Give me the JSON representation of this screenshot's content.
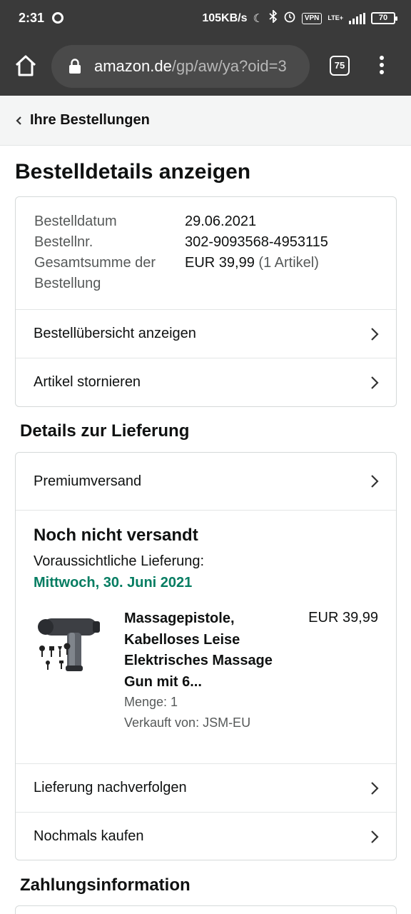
{
  "status_bar": {
    "time": "2:31",
    "speed": "105KB/s",
    "vpn": "VPN",
    "network": "LTE+",
    "battery": "70"
  },
  "browser": {
    "url_domain": "amazon.de",
    "url_path": "/gp/aw/ya?oid=3",
    "tab_count": "75"
  },
  "nav": {
    "back_label": "Ihre Bestellungen"
  },
  "page": {
    "title": "Bestelldetails anzeigen"
  },
  "summary": {
    "rows": [
      {
        "key": "Bestelldatum",
        "value": "29.06.2021"
      },
      {
        "key": "Bestellnr.",
        "value": "302-9093568-4953115"
      },
      {
        "key": "Gesamtsumme der Bestellung",
        "value": "EUR 39,99",
        "extra": "(1 Artikel)"
      }
    ],
    "links": [
      {
        "label": "Bestellübersicht anzeigen"
      },
      {
        "label": "Artikel stornieren"
      }
    ]
  },
  "delivery": {
    "section_title": "Details zur Lieferung",
    "shipping_method": "Premiumversand",
    "status": "Noch nicht versandt",
    "eta_label": "Voraussichtliche Lieferung:",
    "eta_date": "Mittwoch, 30. Juni 2021",
    "product": {
      "title": "Massagepistole, Kabelloses Leise Elektrisches Massage Gun mit 6...",
      "price": "EUR 39,99",
      "quantity": "Menge: 1",
      "seller": "Verkauft von: JSM-EU"
    },
    "links": [
      {
        "label": "Lieferung nachverfolgen"
      },
      {
        "label": "Nochmals kaufen"
      }
    ]
  },
  "payment": {
    "section_title": "Zahlungsinformation"
  },
  "colors": {
    "status_bar": "#3a3a3a",
    "accent_green": "#067d62",
    "muted_text": "#565959",
    "border": "#d5d9d9"
  }
}
